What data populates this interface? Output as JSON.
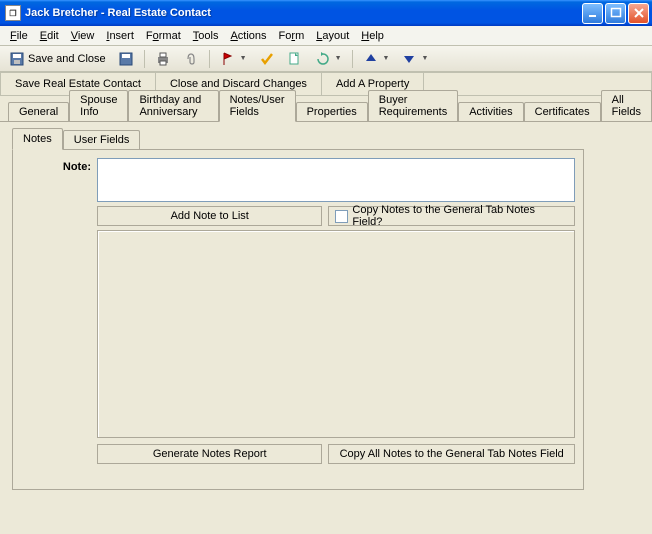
{
  "window": {
    "title": "Jack Bretcher - Real Estate Contact"
  },
  "menu": {
    "items": [
      "File",
      "Edit",
      "View",
      "Insert",
      "Format",
      "Tools",
      "Actions",
      "Form",
      "Layout",
      "Help"
    ]
  },
  "toolbar": {
    "saveclose": "Save and Close"
  },
  "actions": {
    "save": "Save Real Estate Contact",
    "discard": "Close and Discard Changes",
    "addprop": "Add A Property"
  },
  "tabs1": [
    "General",
    "Spouse Info",
    "Birthday and Anniversary",
    "Notes/User Fields",
    "Properties",
    "Buyer Requirements",
    "Activities",
    "Certificates",
    "All Fields"
  ],
  "tabs2": [
    "Notes",
    "User Fields"
  ],
  "form": {
    "noteLabel": "Note:",
    "noteValue": "",
    "addNote": "Add Note to List",
    "copyChk": "Copy Notes to the General Tab Notes Field?",
    "genReport": "Generate Notes Report",
    "copyAll": "Copy All Notes to the General Tab Notes Field"
  }
}
